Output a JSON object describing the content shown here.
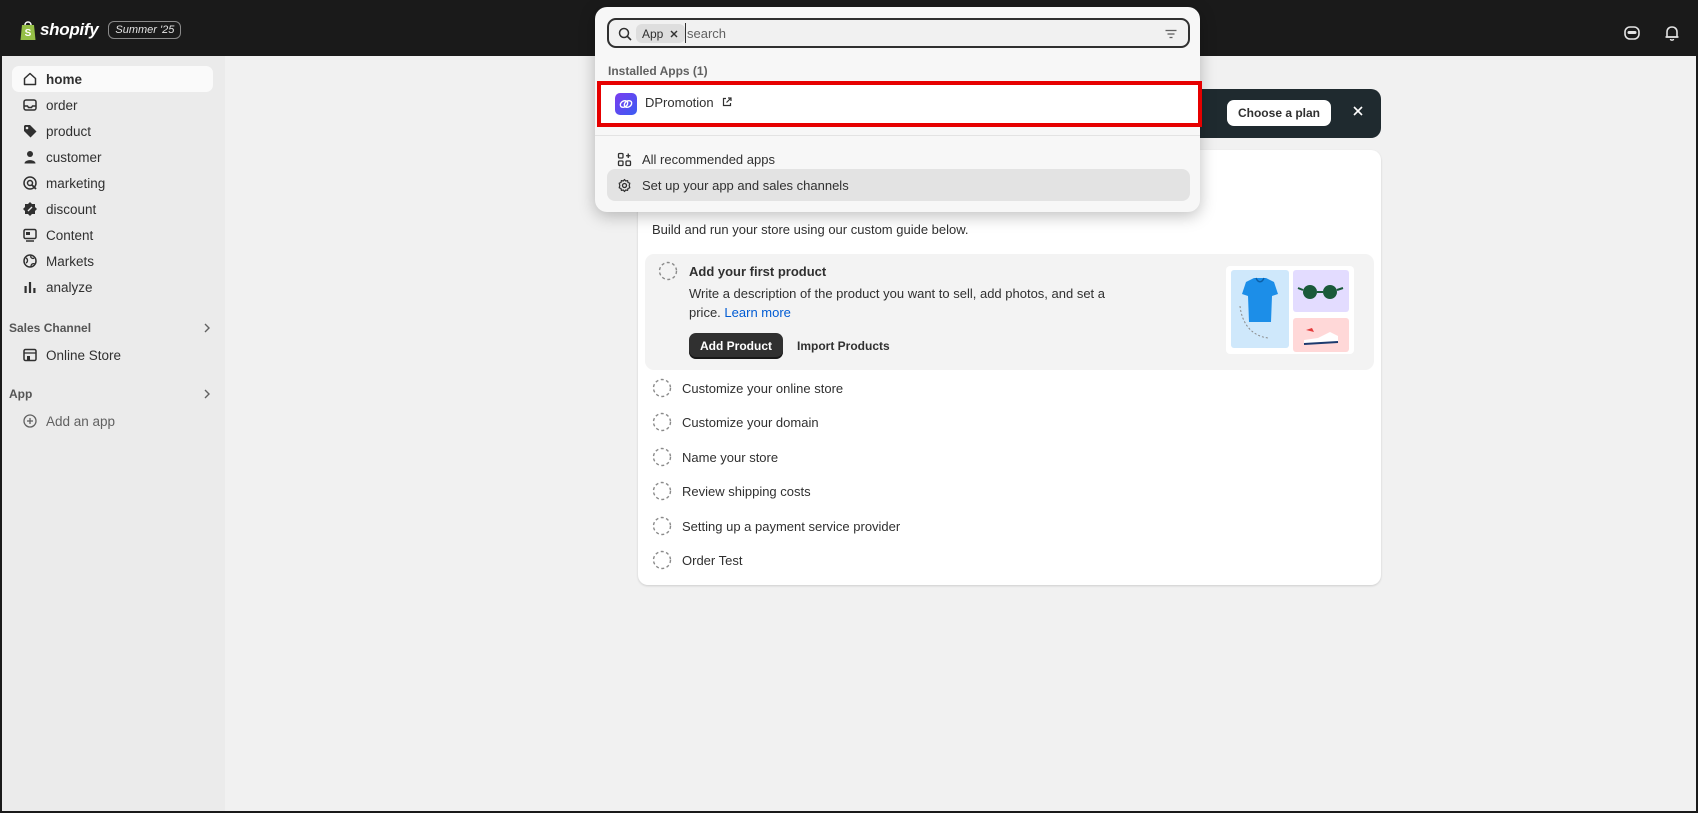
{
  "topbar": {
    "brand_name": "shopify",
    "edition_badge": "Summer '25"
  },
  "sidebar": {
    "items": [
      {
        "label": "home",
        "icon": "home-icon"
      },
      {
        "label": "order",
        "icon": "inbox-icon"
      },
      {
        "label": "product",
        "icon": "tag-icon"
      },
      {
        "label": "customer",
        "icon": "person-icon"
      },
      {
        "label": "marketing",
        "icon": "target-icon"
      },
      {
        "label": "discount",
        "icon": "discount-icon"
      },
      {
        "label": "Content",
        "icon": "content-icon"
      },
      {
        "label": "Markets",
        "icon": "globe-icon"
      },
      {
        "label": "analyze",
        "icon": "bar-chart-icon"
      }
    ],
    "sales_channel_heading": "Sales Channel",
    "online_store_label": "Online Store",
    "app_heading": "App",
    "add_app_label": "Add an app"
  },
  "banner": {
    "choose_plan_label": "Choose a plan"
  },
  "setup_guide": {
    "intro": "Build and run your store using our custom guide below.",
    "active_task": {
      "title": "Add your first product",
      "description": "Write a description of the product you want to sell, add photos, and set a price.",
      "learn_more": "Learn more",
      "primary_button": "Add Product",
      "secondary_button": "Import Products"
    },
    "tasks": [
      "Customize your online store",
      "Customize your domain",
      "Name your store",
      "Review shipping costs",
      "Setting up a payment service provider",
      "Order Test"
    ]
  },
  "search_popover": {
    "filter_chip": "App",
    "placeholder": "search",
    "group_label": "Installed Apps (1)",
    "installed_app": "DPromotion",
    "recommended_label": "All recommended apps",
    "setup_label": "Set up your app and sales channels"
  },
  "colors": {
    "topbar": "#1a1a1a",
    "highlight_border": "#e60000",
    "link": "#005bd3",
    "primary_button": "#303030"
  }
}
